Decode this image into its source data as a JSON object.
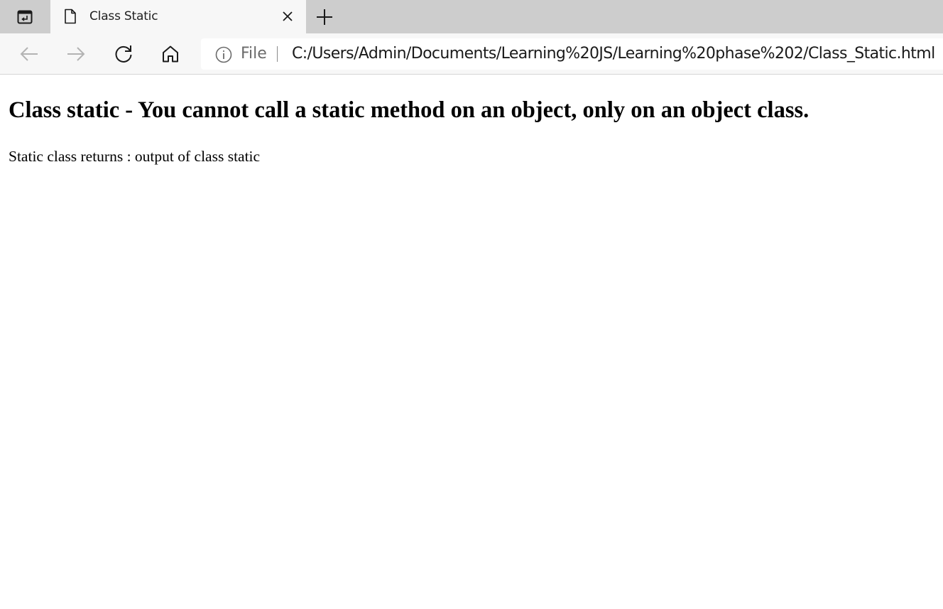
{
  "browser": {
    "tab": {
      "title": "Class Static",
      "icon": "page-icon"
    },
    "address_bar": {
      "scheme_label": "File",
      "url": "C:/Users/Admin/Documents/Learning%20JS/Learning%20phase%202/Class_Static.html"
    },
    "icons": [
      "tab-actions-icon",
      "page-icon",
      "close-icon",
      "plus-icon",
      "back-arrow-icon",
      "forward-arrow-icon",
      "refresh-icon",
      "home-icon",
      "info-icon"
    ]
  },
  "page": {
    "heading": "Class static - You cannot call a static method on an object, only on an object class.",
    "paragraph": "Static class returns : output of class static"
  }
}
